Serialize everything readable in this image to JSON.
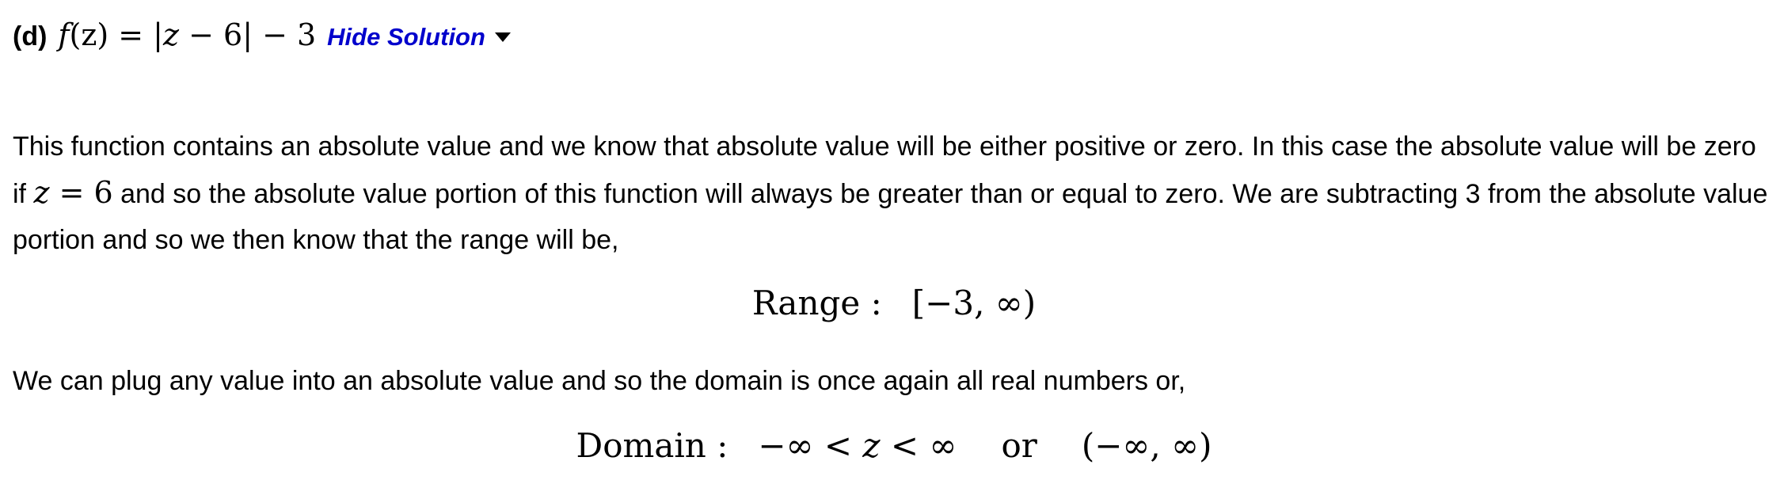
{
  "header": {
    "part_label": "(d)",
    "function_lhs": "f",
    "function_var": "(z)",
    "function_rhs_prefix": " = |",
    "function_rhs_var": "z",
    "function_rhs_suffix": " − 6| − 3",
    "toggle_label": "Hide Solution"
  },
  "paragraph1": {
    "text_before": "This function contains an absolute value and we know that absolute value will be either positive or zero. In this case the absolute value will be zero if ",
    "math_var": "z",
    "math_rest": " = 6",
    "text_after": " and so the absolute value portion of this function will always be greater than or equal to zero. We are subtracting 3 from the absolute value portion and so we then know that the range will be,"
  },
  "range_display": {
    "label": "Range :",
    "value": "[−3, ∞)"
  },
  "paragraph2": {
    "text": "We can plug any value into an absolute value and so the domain is once again all real numbers or,"
  },
  "domain_display": {
    "label": "Domain :",
    "inequality_left": "−∞ < ",
    "inequality_var": "z",
    "inequality_right": " < ∞",
    "connector": "or",
    "interval": "(−∞, ∞)"
  }
}
